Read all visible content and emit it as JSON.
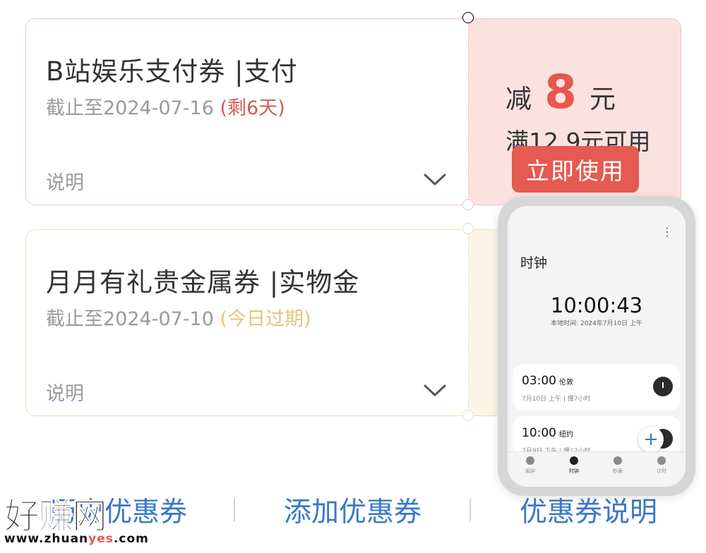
{
  "coupons": [
    {
      "title": "B站娱乐支付券 |支付",
      "expiry": "截止至2024-07-16",
      "status": "(剩6天)",
      "desc_label": "说明",
      "discount_prefix": "减",
      "discount_amount": "8",
      "discount_unit": "元",
      "threshold": "满12.9元可用",
      "use_button": "立即使用"
    },
    {
      "title": "月月有礼贵金属券 |实物金",
      "expiry": "截止至2024-07-10",
      "status": "(今日过期)",
      "desc_label": "说明"
    }
  ],
  "bottom_links": {
    "history": "历史优惠券",
    "add": "添加优惠券",
    "explain": "优惠券说明"
  },
  "watermark": {
    "cn": "好赚网",
    "en_prefix": "www.zhuan",
    "en_highlight": "yes",
    "en_suffix": ".com"
  },
  "clock_app": {
    "menu": "⋮",
    "title": "时钟",
    "time": "10:00:43",
    "local_time": "本地时间: 2024年7月10日 上午",
    "cities": [
      {
        "time": "03:00",
        "city": "伦敦",
        "sub": "7月10日 上午 | 慢7小时"
      },
      {
        "time": "10:00",
        "city": "纽约",
        "sub": "7月9日 下午 | 慢12小时"
      }
    ],
    "fab": "+",
    "tabs": [
      "闹钟",
      "时钟",
      "秒表",
      "计时"
    ],
    "active_tab": "时钟"
  },
  "colors": {
    "accent_red": "#e55a51",
    "link_blue": "#3a78c8",
    "expiring_gold": "#e4c47c"
  }
}
